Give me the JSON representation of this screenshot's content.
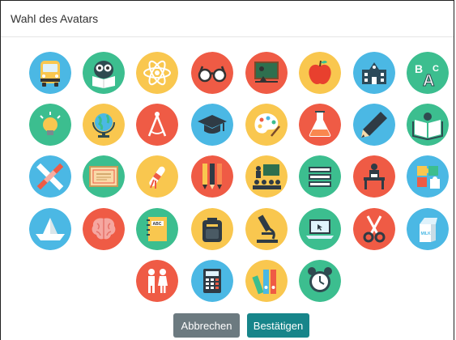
{
  "dialog": {
    "title": "Wahl des Avatars",
    "cancel_label": "Abbrechen",
    "confirm_label": "Bestätigen"
  },
  "avatars": [
    {
      "icon": "school-bus-icon",
      "bg": "#4bb8e4"
    },
    {
      "icon": "owl-reading-icon",
      "bg": "#3cbe8f"
    },
    {
      "icon": "atom-icon",
      "bg": "#f9c74f"
    },
    {
      "icon": "glasses-icon",
      "bg": "#ef5b45"
    },
    {
      "icon": "chalkboard-icon",
      "bg": "#ef5b45"
    },
    {
      "icon": "apple-icon",
      "bg": "#f9c74f"
    },
    {
      "icon": "school-building-icon",
      "bg": "#4bb8e4"
    },
    {
      "icon": "abc-letters-icon",
      "bg": "#3cbe8f"
    },
    {
      "icon": "lightbulb-icon",
      "bg": "#3cbe8f"
    },
    {
      "icon": "globe-icon",
      "bg": "#f9c74f"
    },
    {
      "icon": "compass-tool-icon",
      "bg": "#ef5b45"
    },
    {
      "icon": "graduation-cap-icon",
      "bg": "#4bb8e4"
    },
    {
      "icon": "paint-palette-icon",
      "bg": "#f9c74f"
    },
    {
      "icon": "flask-icon",
      "bg": "#ef5b45"
    },
    {
      "icon": "pencil-icon",
      "bg": "#4bb8e4"
    },
    {
      "icon": "open-book-icon",
      "bg": "#3cbe8f"
    },
    {
      "icon": "ruler-pencil-icon",
      "bg": "#4bb8e4"
    },
    {
      "icon": "certificate-icon",
      "bg": "#3cbe8f"
    },
    {
      "icon": "diploma-scroll-icon",
      "bg": "#f9c74f"
    },
    {
      "icon": "pens-icon",
      "bg": "#ef5b45"
    },
    {
      "icon": "teacher-class-icon",
      "bg": "#f9c74f"
    },
    {
      "icon": "book-stack-icon",
      "bg": "#3cbe8f"
    },
    {
      "icon": "student-desk-icon",
      "bg": "#ef5b45"
    },
    {
      "icon": "puzzle-icon",
      "bg": "#4bb8e4"
    },
    {
      "icon": "paper-boat-icon",
      "bg": "#4bb8e4"
    },
    {
      "icon": "brain-icon",
      "bg": "#ef5b45"
    },
    {
      "icon": "notebook-abc-icon",
      "bg": "#3cbe8f"
    },
    {
      "icon": "backpack-icon",
      "bg": "#f9c74f"
    },
    {
      "icon": "microscope-icon",
      "bg": "#f9c74f"
    },
    {
      "icon": "laptop-icon",
      "bg": "#3cbe8f"
    },
    {
      "icon": "scissors-icon",
      "bg": "#ef5b45"
    },
    {
      "icon": "milk-carton-icon",
      "bg": "#4bb8e4"
    },
    {
      "icon": "boy-girl-icon",
      "bg": "#ef5b45"
    },
    {
      "icon": "calculator-icon",
      "bg": "#4bb8e4"
    },
    {
      "icon": "binders-icon",
      "bg": "#f9c74f"
    },
    {
      "icon": "alarm-clock-icon",
      "bg": "#3cbe8f"
    }
  ]
}
